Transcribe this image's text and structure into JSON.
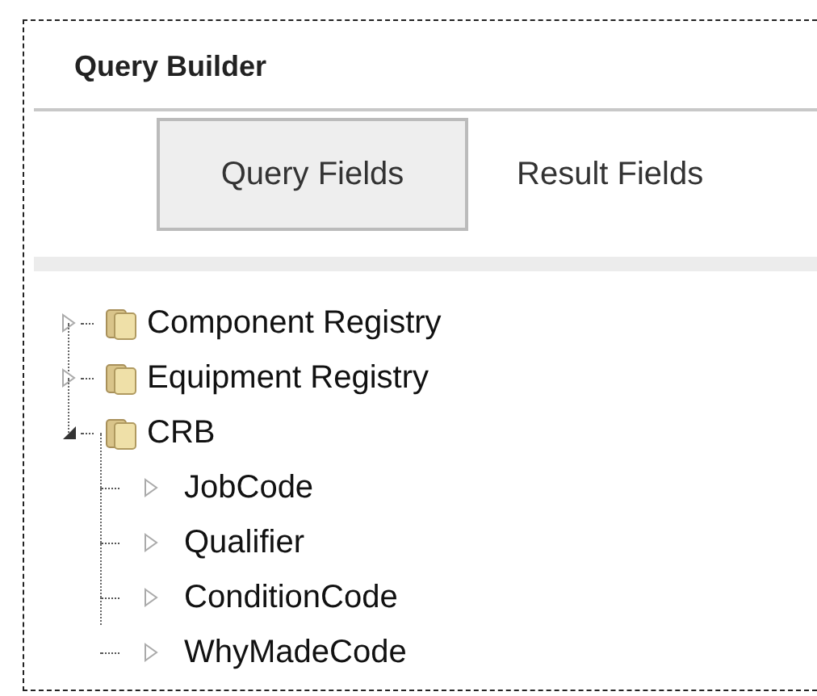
{
  "panel": {
    "title": "Query Builder"
  },
  "tabs": [
    {
      "label": "Query Fields",
      "selected": true
    },
    {
      "label": "Result Fields",
      "selected": false
    }
  ],
  "tree": [
    {
      "label": "Component Registry",
      "kind": "folder",
      "expanded": false
    },
    {
      "label": "Equipment Registry",
      "kind": "folder",
      "expanded": false
    },
    {
      "label": "CRB",
      "kind": "folder",
      "expanded": true,
      "children": [
        {
          "label": "JobCode",
          "kind": "field",
          "expanded": false
        },
        {
          "label": "Qualifier",
          "kind": "field",
          "expanded": false
        },
        {
          "label": "ConditionCode",
          "kind": "field",
          "expanded": false
        },
        {
          "label": "WhyMadeCode",
          "kind": "field",
          "expanded": false
        }
      ]
    }
  ]
}
